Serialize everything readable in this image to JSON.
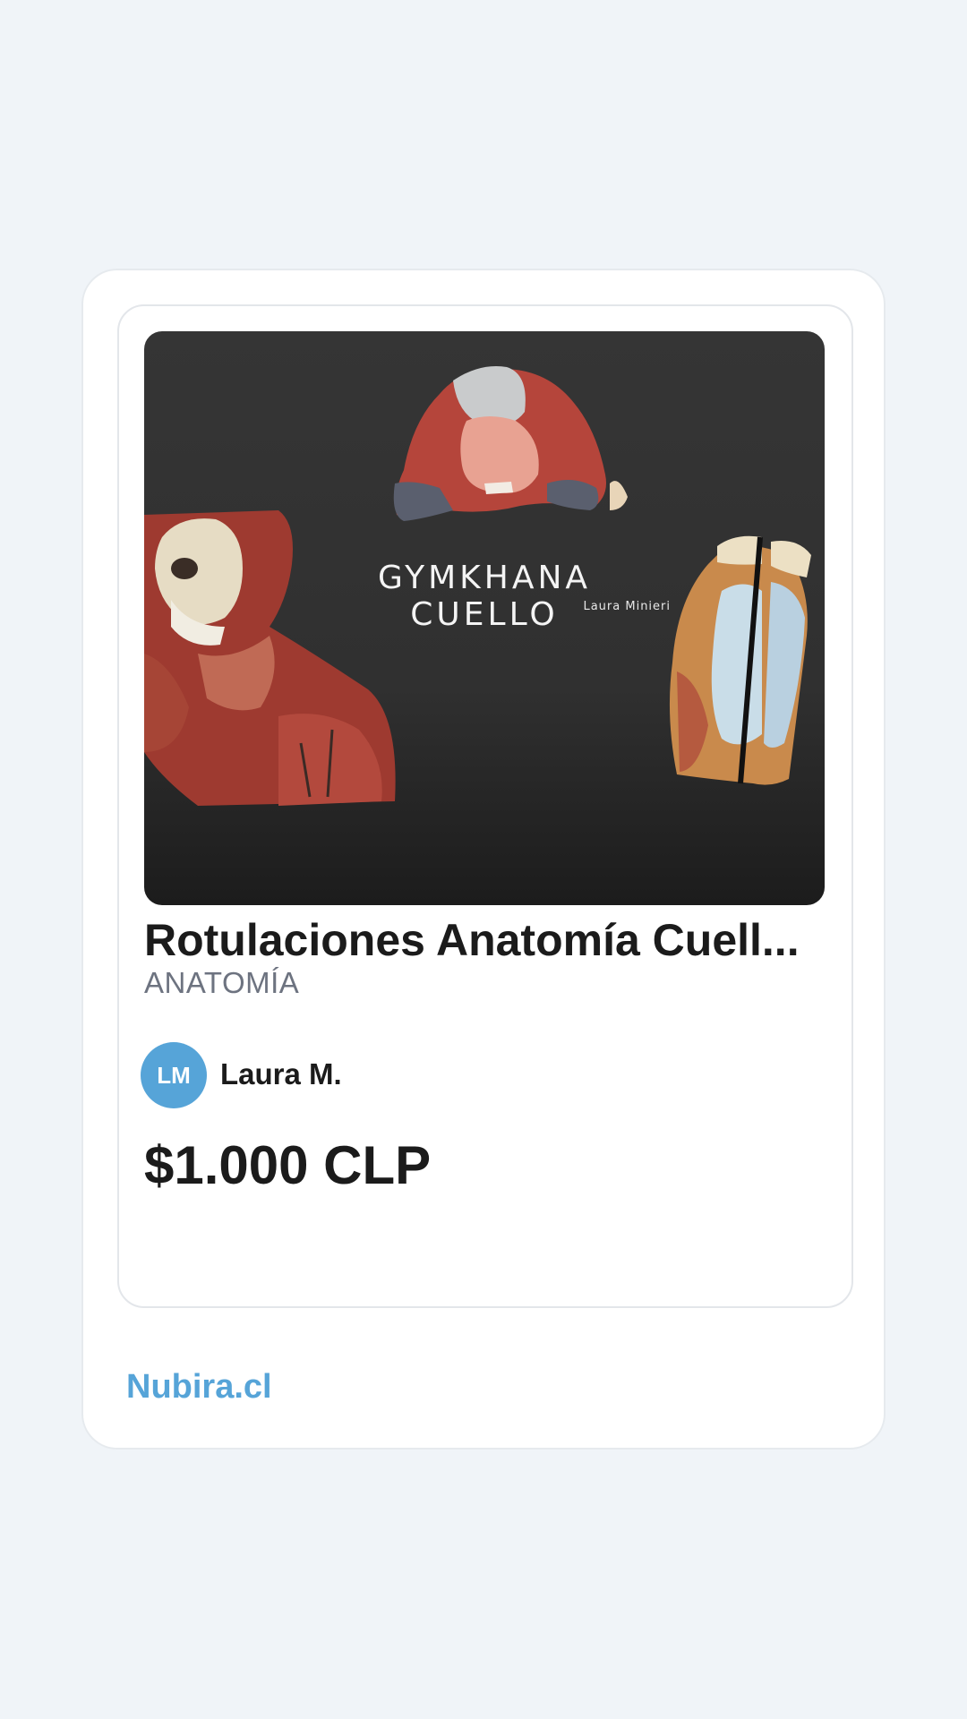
{
  "product": {
    "image": {
      "title_text": "GYMKHANA CUELLO",
      "author_text": "Laura Minieri"
    },
    "title": "Rotulaciones Anatomía Cuell...",
    "category": "ANATOMÍA",
    "seller": {
      "initials": "LM",
      "name": "Laura M."
    },
    "price": "$1.000 CLP"
  },
  "footer": {
    "brand": "Nubira.cl"
  },
  "colors": {
    "accent": "#56a4d8",
    "page_background": "#f0f4f8",
    "text_primary": "#1b1b1b",
    "text_secondary": "#6d7380"
  }
}
